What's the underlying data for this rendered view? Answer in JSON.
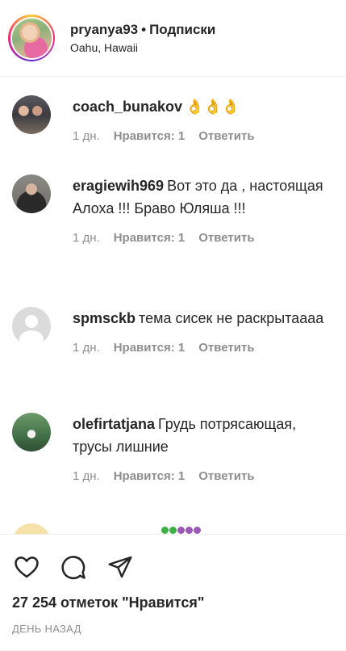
{
  "header": {
    "username": "pryanya93",
    "separator": "•",
    "follow_label": "Подписки",
    "location": "Oahu, Hawaii"
  },
  "comments": [
    {
      "username": "coach_bunakov",
      "text": "👌👌👌",
      "time": "1 дн.",
      "likes": "Нравится: 1",
      "reply": "Ответить"
    },
    {
      "username": "eragiewih969",
      "text": "Вот это да , настоящая Алоха !!! Браво Юляша !!!",
      "time": "1 дн.",
      "likes": "Нравится: 1",
      "reply": "Ответить"
    },
    {
      "username": "spmsckb",
      "text": "тема сисек не раскрытаааа",
      "time": "1 дн.",
      "likes": "Нравится: 1",
      "reply": "Ответить"
    },
    {
      "username": "olefirtatjana",
      "text": "Грудь потрясающая, трусы лишние",
      "time": "1 дн.",
      "likes": "Нравится: 1",
      "reply": "Ответить"
    }
  ],
  "icons": {
    "like": "heart-icon",
    "comment": "comment-icon",
    "share": "share-icon",
    "default_avatar": "default-avatar-icon"
  },
  "footer": {
    "likes_count": "27 254 отметок \"Нравится\"",
    "timestamp": "ДЕНЬ НАЗАД"
  },
  "colors": {
    "text": "#262626",
    "secondary": "#8e8e8e",
    "divider": "#efefef"
  }
}
